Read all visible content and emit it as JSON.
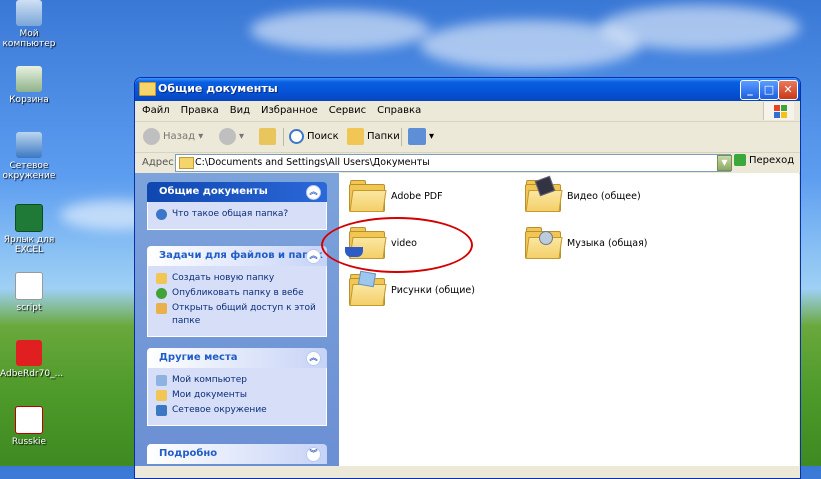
{
  "desktop": {
    "icons": [
      {
        "label": "Мой компьютер"
      },
      {
        "label": "Корзина"
      },
      {
        "label": "Сетевое окружение"
      },
      {
        "label": "Ярлык для EXCEL"
      },
      {
        "label": "script"
      },
      {
        "label": "AdbeRdr70_..."
      },
      {
        "label": "Russkie"
      }
    ]
  },
  "window": {
    "title": "Общие документы",
    "menu": [
      "Файл",
      "Правка",
      "Вид",
      "Избранное",
      "Сервис",
      "Справка"
    ],
    "toolbar": {
      "back": "Назад",
      "search": "Поиск",
      "folders": "Папки"
    },
    "address": {
      "label": "Адрес:",
      "path": "C:\\Documents and Settings\\All Users\\Документы",
      "go": "Переход"
    },
    "taskpane": {
      "box1": {
        "title": "Общие документы",
        "items": [
          "Что такое общая папка?"
        ]
      },
      "box2": {
        "title": "Задачи для файлов и папок",
        "items": [
          "Создать новую папку",
          "Опубликовать папку в вебе",
          "Открыть общий доступ к этой папке"
        ]
      },
      "box3": {
        "title": "Другие места",
        "items": [
          "Мой компьютер",
          "Мои документы",
          "Сетевое окружение"
        ]
      },
      "box4": {
        "title": "Подробно"
      }
    },
    "files": [
      "Adobe PDF",
      "Видео (общее)",
      "video",
      "Музыка (общая)",
      "Рисунки (общие)"
    ]
  },
  "colors": {
    "titlebar": "#0553d8",
    "taskpane": "#7da3dc",
    "highlight": "#d40000"
  }
}
